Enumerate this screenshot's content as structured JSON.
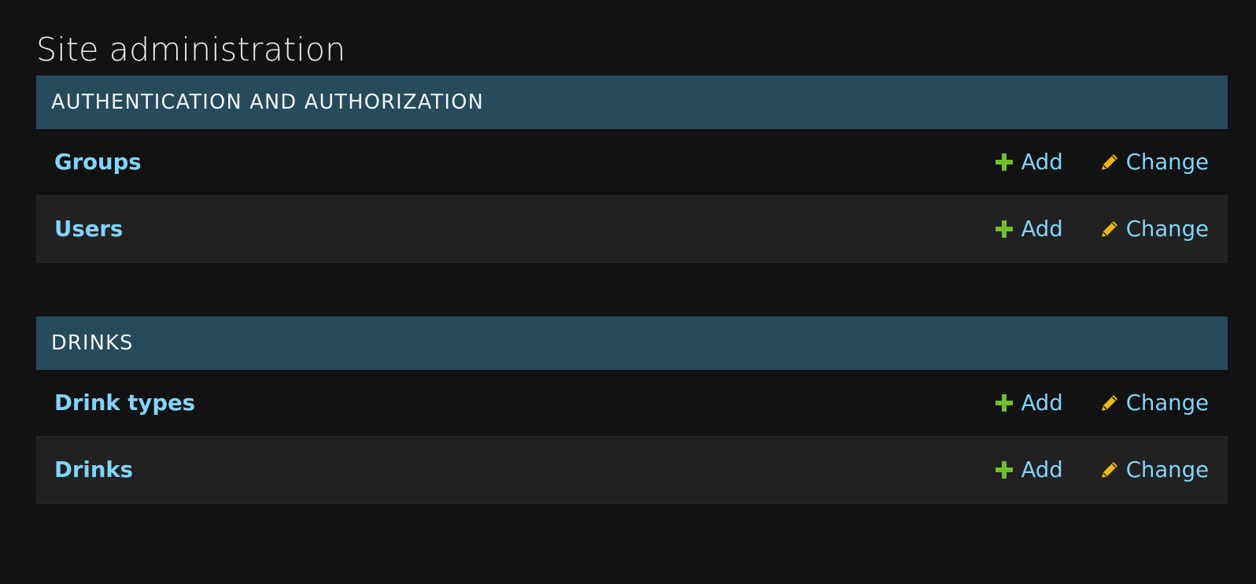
{
  "page": {
    "title": "Site administration"
  },
  "modules": [
    {
      "caption": "AUTHENTICATION AND AUTHORIZATION",
      "models": [
        {
          "name": "Groups",
          "add_label": "Add",
          "change_label": "Change"
        },
        {
          "name": "Users",
          "add_label": "Add",
          "change_label": "Change"
        }
      ]
    },
    {
      "caption": "DRINKS",
      "models": [
        {
          "name": "Drink types",
          "add_label": "Add",
          "change_label": "Change"
        },
        {
          "name": "Drinks",
          "add_label": "Add",
          "change_label": "Change"
        }
      ]
    }
  ],
  "icons": {
    "add": "plus-icon",
    "change": "pencil-icon"
  },
  "colors": {
    "background": "#121212",
    "module_header": "#264b5d",
    "link": "#81d4fa",
    "add_icon": "#70bf2b",
    "change_icon": "#efb80b",
    "row_alt": "#212121"
  }
}
